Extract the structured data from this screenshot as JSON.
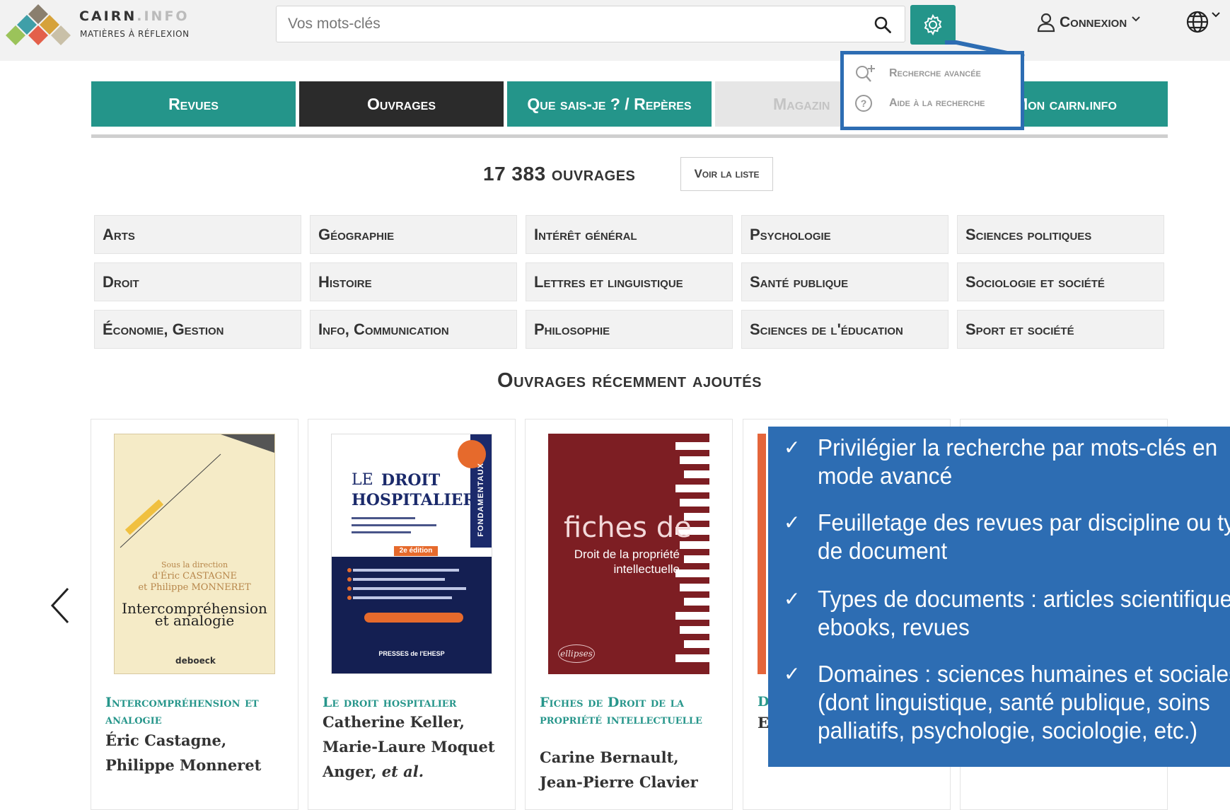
{
  "header": {
    "logo_name": "CAIRN",
    "logo_dot": ".INFO",
    "logo_tagline": "MATIÈRES À RÉFLEXION",
    "search_placeholder": "Vos mots-clés",
    "login_label": "Connexion"
  },
  "dropdown": {
    "advanced_search": "Recherche avancée",
    "search_help": "Aide à la recherche"
  },
  "nav": {
    "tabs": [
      {
        "label": "Revues",
        "color": "#24958a"
      },
      {
        "label": "Ouvrages",
        "color": "#2b2b2b"
      },
      {
        "label": "Que sais-je ? / Repères",
        "color": "#24958a"
      },
      {
        "label": "Magazin",
        "color": "#e6e6e6"
      },
      {
        "label": "Mon cairn.info",
        "color": "#24958a"
      }
    ]
  },
  "count": {
    "label": "17 383 ouvrages",
    "see_list": "Voir la liste"
  },
  "categories": [
    "Arts",
    "Géographie",
    "Intérêt général",
    "Psychologie",
    "Sciences politiques",
    "Droit",
    "Histoire",
    "Lettres et linguistique",
    "Santé publique",
    "Sociologie et société",
    "Économie, Gestion",
    "Info, Communication",
    "Philosophie",
    "Sciences de l'éducation",
    "Sport et société"
  ],
  "recent_title": "Ouvrages récemment ajoutés",
  "books": [
    {
      "title": "Intercompréhension et analogie",
      "authors": "Éric Castagne, Philippe Monneret",
      "cover": {
        "direction_line1": "Sous la direction",
        "direction_line2": "d'Éric CASTAGNE",
        "direction_line3": "et Philippe MONNERET",
        "title_line1": "Intercompréhension",
        "title_line2": "et analogie",
        "publisher": "deboeck"
      }
    },
    {
      "title": "Le droit hospitalier",
      "authors_main": "Catherine Keller, Marie-Laure Moquet Anger, ",
      "authors_etal": "et al.",
      "cover": {
        "le": "LE",
        "droit": "DROIT",
        "hospitalier": "HOSPITALIER",
        "edition": "2e édition",
        "publisher": "PRESSES de l'EHESP",
        "series": "FONDAMENTAUX"
      }
    },
    {
      "title": "Fiches de Droit de la propriété intellectuelle",
      "authors": "Carine Bernault, Jean-Pierre Clavier",
      "cover": {
        "fiches": "fiches de",
        "subtitle_line1": "Droit de la propriété",
        "subtitle_line2": "intellectuelle",
        "publisher": "ellipses"
      }
    },
    {
      "title_fragment": "D",
      "author_fragment": "E"
    }
  ],
  "info_panel": {
    "items": [
      {
        "line1": "Privilégier la recherche par mots-clés en",
        "line2": "mode avancé"
      },
      {
        "line1": "Feuilletage des revues par discipline ou typ",
        "line2": "de document"
      },
      {
        "line1": "Types de documents : articles scientifiques",
        "line2": "ebooks, revues"
      },
      {
        "line1": "Domaines : sciences humaines et sociales",
        "line2": "(dont linguistique, santé publique, soins",
        "line3": "palliatifs, psychologie, sociologie, etc.)"
      }
    ]
  },
  "colors": {
    "teal": "#24958a",
    "dark": "#2b2b2b",
    "panel_blue": "#2d6db3"
  }
}
